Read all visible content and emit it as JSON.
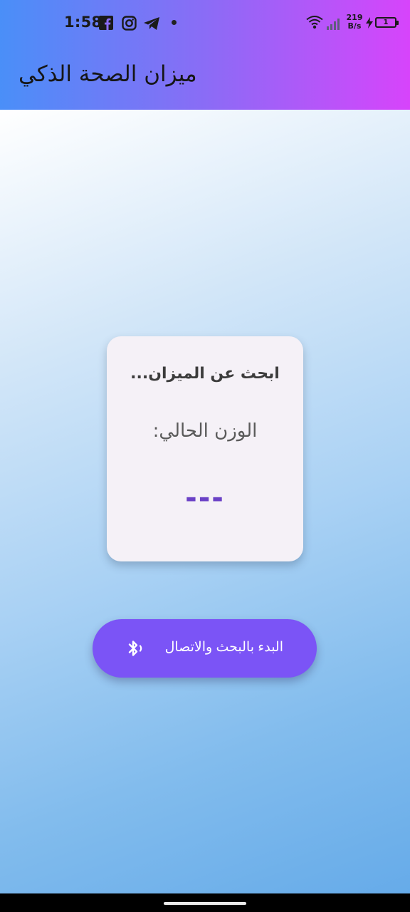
{
  "status_bar": {
    "time": "1:58",
    "net_speed_value": "219",
    "net_speed_unit": "B/s",
    "battery_level": "1",
    "icons": [
      "facebook-icon",
      "instagram-icon",
      "telegram-icon",
      "notification-dot",
      "wifi-icon",
      "signal-icon",
      "charging-bolt-icon",
      "battery-icon"
    ]
  },
  "app_bar": {
    "title": "ميزان الصحة الذكي"
  },
  "card": {
    "status": "...ابحث عن الميزان",
    "weight_label": ":الوزن الحالي",
    "weight_value": "---"
  },
  "connect_button": {
    "label": "البدء بالبحث والاتصال",
    "icon": "bluetooth-searching-icon"
  },
  "colors": {
    "app_bar_gradient_start": "#4a8ff8",
    "app_bar_gradient_end": "#d744fb",
    "button": "#7b54f6",
    "weight_value": "#6a41c6",
    "card_background": "#f5f1f7"
  }
}
